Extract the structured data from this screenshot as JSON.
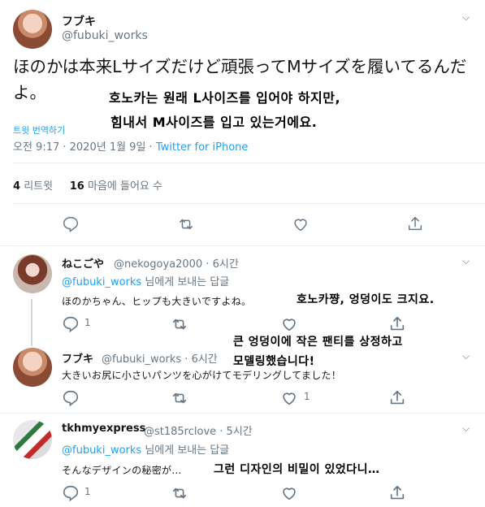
{
  "main_tweet": {
    "name": "フブキ",
    "handle": "@fubuki_works",
    "text": "ほのかは本来Lサイズだけど頑張ってMサイズを履いてるんだよ。",
    "overlay_line1": "호노카는 원래 L사이즈를 입어야 하지만,",
    "overlay_line2": "힘내서 M사이즈를 입고 있는거에요.",
    "translate_label": "트윗 번역하기",
    "time": "오전 9:17 · 2020년 1월 9일 · ",
    "app": "Twitter for iPhone",
    "retweets_count": "4",
    "retweets_label": "리트윗",
    "likes_count": "16",
    "likes_label": "마음에 들어요 수"
  },
  "replies": [
    {
      "name": "ねこごや",
      "handle": "@nekogoya2000 · 6시간",
      "reply_to_mention": "@fubuki_works",
      "reply_to_suffix": " 님에게 보내는 답글",
      "text": "ほのかちゃん、ヒップも大きいですよね。",
      "overlay": "호노카쨩, 엉덩이도 크지요.",
      "reply_count": "1",
      "retweet_count": "",
      "like_count": ""
    },
    {
      "name": "フブキ",
      "handle": "@fubuki_works · 6시간",
      "text": "大きいお尻に小さいパンツを心がけてモデリングしてました！",
      "overlay_line1": "큰 엉덩이에 작은 팬티를 상정하고",
      "overlay_line2": "모델링했습니다!",
      "reply_count": "",
      "retweet_count": "",
      "like_count": "1"
    },
    {
      "name": "tkhmyexpress",
      "handle": "@st185rclove · 5시간",
      "reply_to_mention": "@fubuki_works",
      "reply_to_suffix": " 님에게 보내는 답글",
      "text": "そんなデザインの秘密が…",
      "overlay": "그런 디자인의 비밀이 있었다니…",
      "reply_count": "1",
      "retweet_count": "",
      "like_count": ""
    }
  ],
  "colors": {
    "accent": "#1da1f2",
    "secondary_text": "#657786",
    "divider": "#e6ecf0"
  },
  "icons": {
    "more": "chevron-down-icon",
    "reply": "reply-icon",
    "retweet": "retweet-icon",
    "like": "heart-icon",
    "share": "share-icon"
  }
}
